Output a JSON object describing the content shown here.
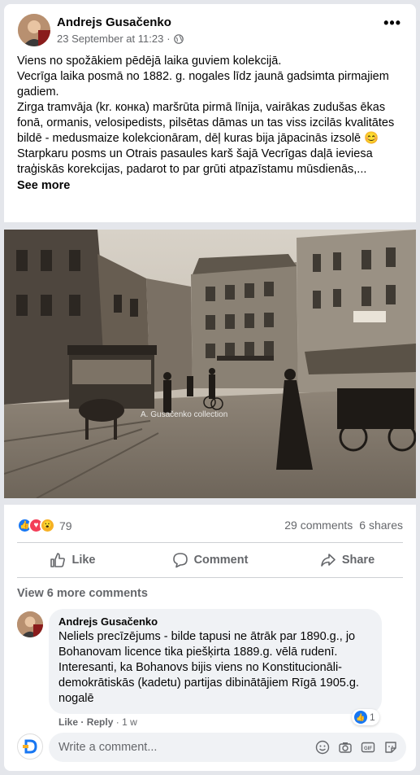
{
  "post": {
    "author": "Andrejs Gusačenko",
    "time": "23 September at 11:23",
    "separator": "·",
    "text_lines": [
      "Viens no spožākiem pēdējā laika guviem kolekcijā.",
      "Vecrīga laika posmā no 1882. g. nogales līdz jaunā gadsimta pirmajiem gadiem.",
      "Zirga tramvāja (kr. конка) maršrūta  pirmā līnija, vairākas zudušas ēkas fonā, ormanis, velosipedists, pilsētas dāmas un tas viss izcilās kvalitātes bildē - medusmaize kolekcionāram, dēļ kuras bija jāpacinās izsolē 😊",
      "Starpkaru posms un Otrais pasaules karš šajā Vecrīgas daļā ieviesa traģiskās korekcijas, padarot to par grūti atpazīstamu mūsdienās,..."
    ],
    "see_more": "See more",
    "photo_watermark": "A. Gusačenko collection",
    "reaction_count": "79",
    "comments_count": "29 comments",
    "shares_count": "6 shares"
  },
  "actions": {
    "like": "Like",
    "comment": "Comment",
    "share": "Share"
  },
  "comments": {
    "view_more": "View 6 more comments",
    "items": [
      {
        "author": "Andrejs Gusačenko",
        "text": "Neliels precīzējums - bilde tapusi ne ātrāk par 1890.g., jo Bohanovam licence tika piešķirta 1889.g. vēlā rudenī. Interesanti, ka Bohanovs bijis viens no Konstitucionāli-demokrātiskās (kadetu) partijas dibinātājiem Rīgā 1905.g. nogalē",
        "like": "Like",
        "reply": "Reply",
        "time": "1 w",
        "reaction_count": "1"
      }
    ]
  },
  "composer": {
    "placeholder": "Write a comment..."
  },
  "colors": {
    "accent": "#1877f2",
    "love": "#f33e58",
    "wow": "#f7b125",
    "secondary_text": "#65676b"
  }
}
